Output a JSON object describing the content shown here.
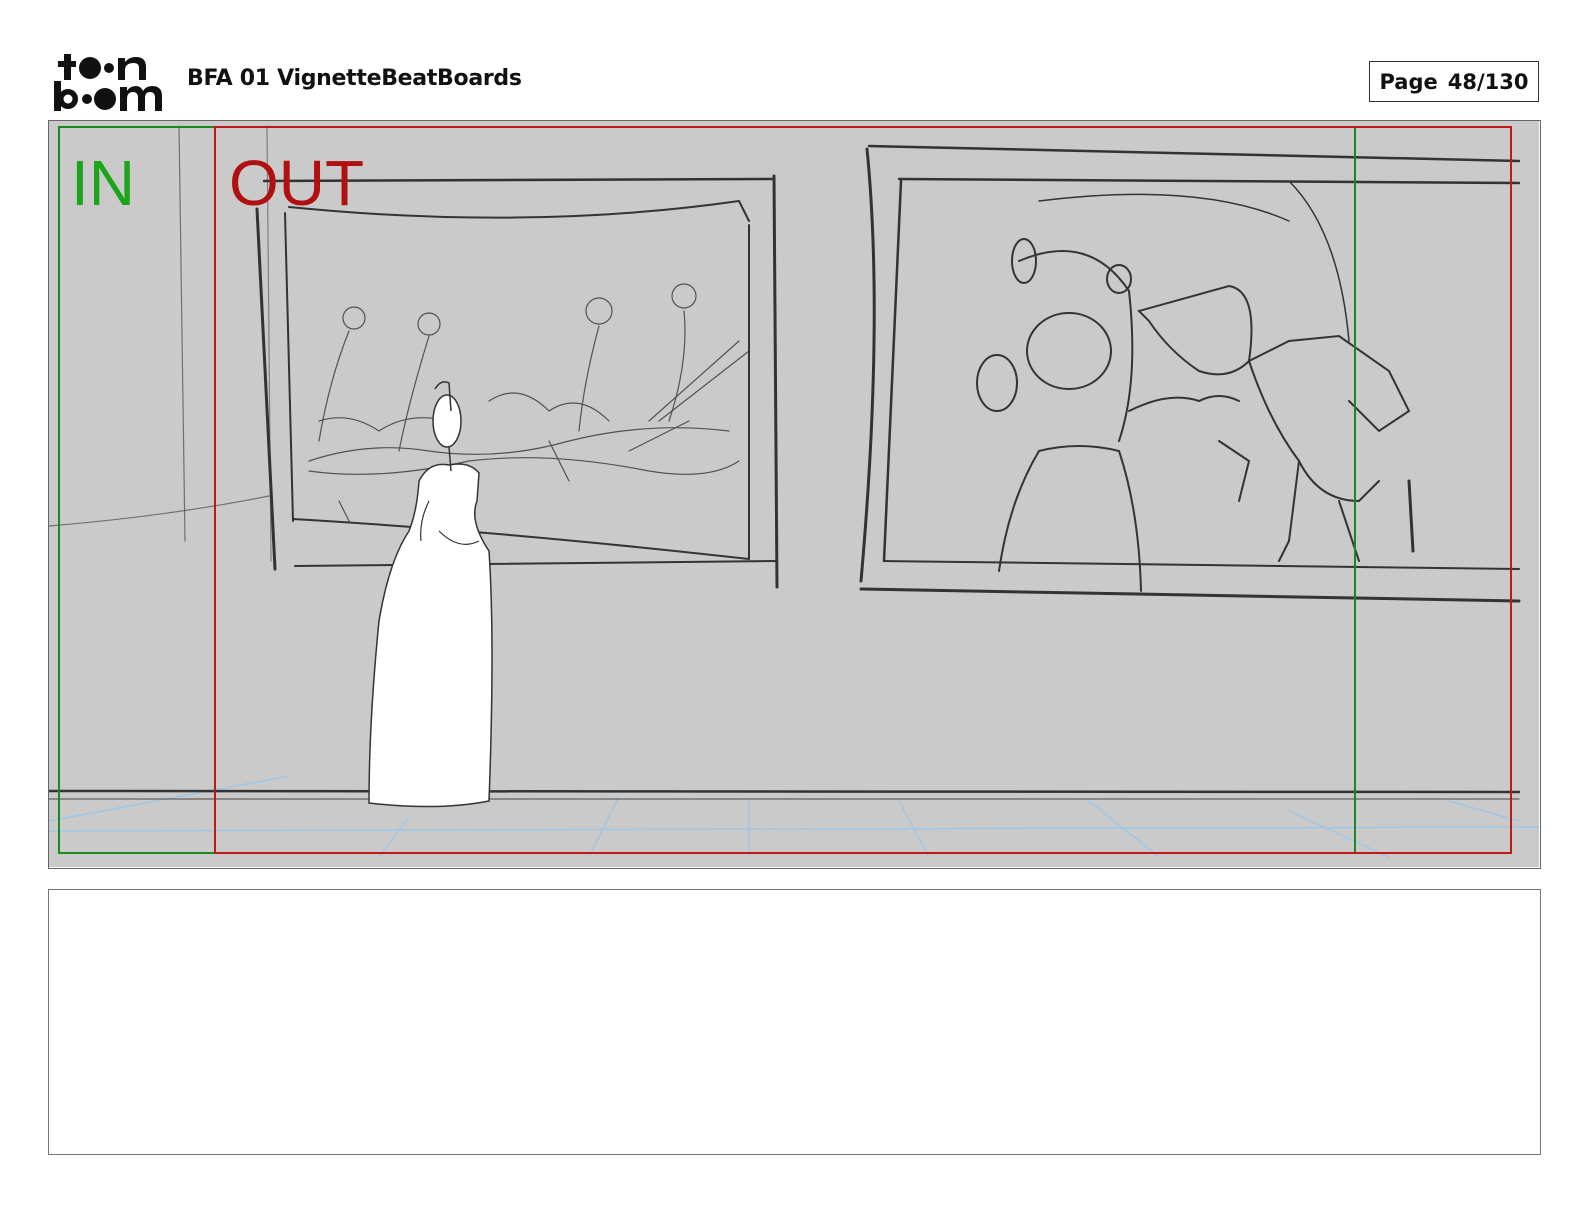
{
  "header": {
    "logo_text_top": "to•n",
    "logo_text_bottom": "b••m",
    "project_title": "BFA 01 VignetteBeatBoards",
    "page_label": "Page",
    "page_number": "48/130"
  },
  "panel": {
    "in_label": "IN",
    "out_label": "OUT",
    "colors": {
      "in_frame": "#1a8a1a",
      "out_frame": "#c01818",
      "background": "#cacaca",
      "sketch": "#333333",
      "floor_grid": "#9ec7e8"
    }
  },
  "caption": {
    "text": ""
  }
}
